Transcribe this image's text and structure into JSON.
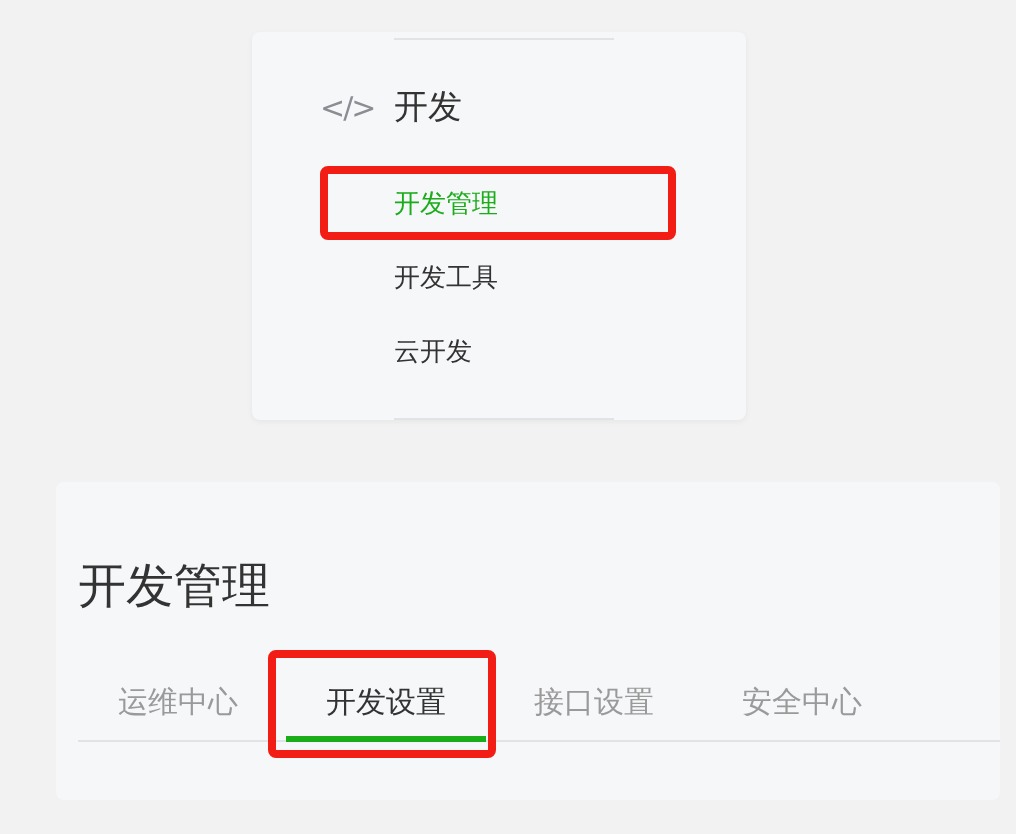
{
  "menu": {
    "icon_text": "</>",
    "title": "开发",
    "items": [
      {
        "label": "开发管理",
        "selected": true,
        "highlighted": true
      },
      {
        "label": "开发工具",
        "selected": false,
        "highlighted": false
      },
      {
        "label": "云开发",
        "selected": false,
        "highlighted": false
      }
    ]
  },
  "panel": {
    "title": "开发管理",
    "tabs": [
      {
        "label": "运维中心",
        "selected": false,
        "highlighted": false
      },
      {
        "label": "开发设置",
        "selected": true,
        "highlighted": true
      },
      {
        "label": "接口设置",
        "selected": false,
        "highlighted": false
      },
      {
        "label": "安全中心",
        "selected": false,
        "highlighted": false
      }
    ]
  }
}
